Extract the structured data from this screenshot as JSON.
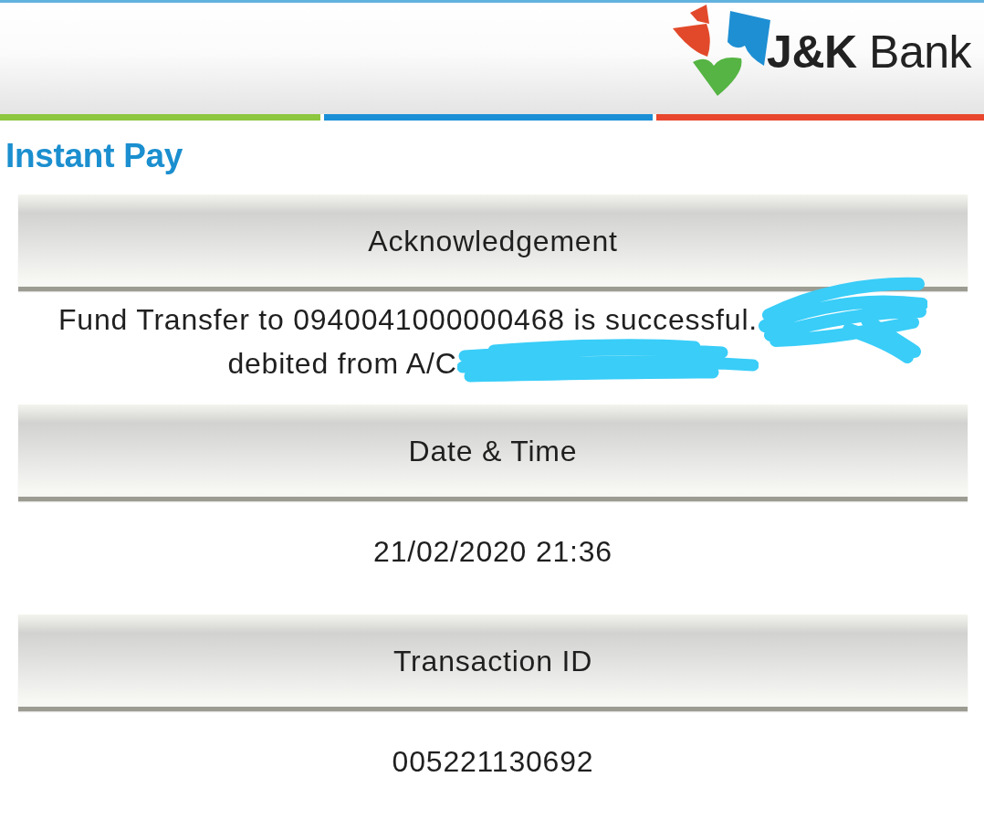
{
  "header": {
    "logo_text": "**J&K** Bank"
  },
  "title": "Instant Pay",
  "sections": [
    {
      "heading": "Acknowledgement",
      "lines": [
        {
          "text": "Fund Transfer to 0940041000000468 is successful.",
          "redacted": true
        },
        {
          "text": "debited from A/C",
          "redacted": true
        }
      ]
    },
    {
      "heading": "Date & Time",
      "lines": [
        {
          "text": "21/02/2020 21:36",
          "redacted": false
        }
      ]
    },
    {
      "heading": "Transaction ID",
      "lines": [
        {
          "text": "005221130692",
          "redacted": false
        }
      ]
    }
  ]
}
